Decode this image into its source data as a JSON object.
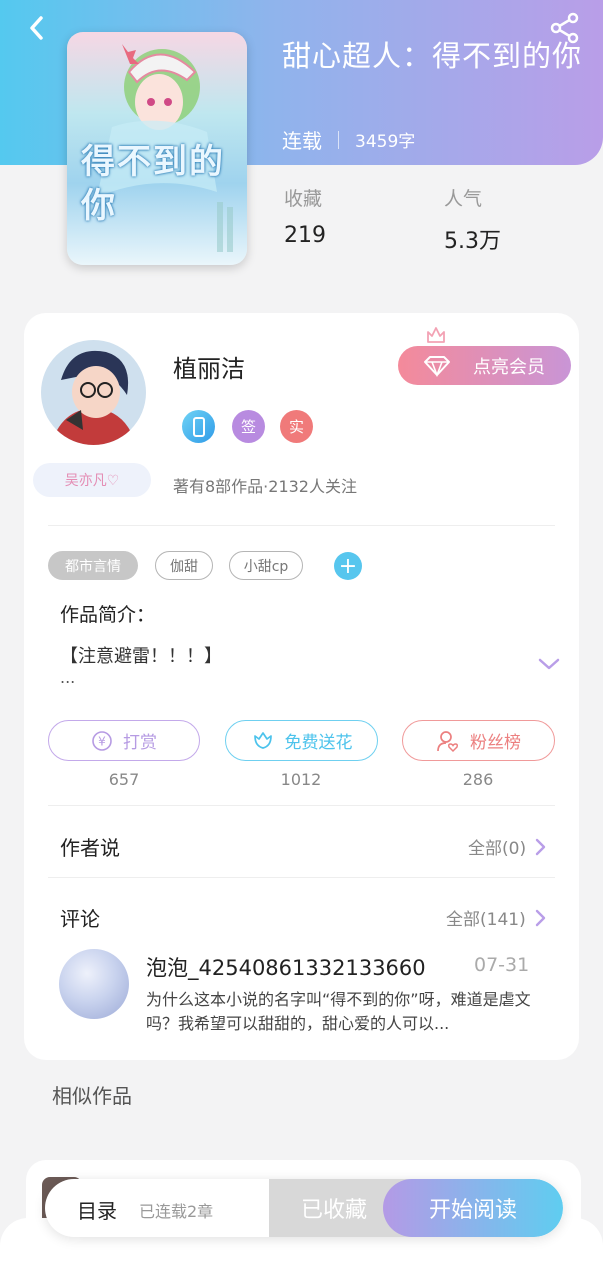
{
  "book": {
    "title": "甜心超人：得不到的你",
    "status": "连载",
    "word_count": "3459字",
    "stats": [
      {
        "label": "收藏",
        "value": "219"
      },
      {
        "label": "人气",
        "value": "5.3万"
      }
    ],
    "cover_text": "得不到的你"
  },
  "author": {
    "name": "植丽洁",
    "vip_button": "点亮会员",
    "badges": [
      "签",
      "实"
    ],
    "tag": "吴亦凡♡",
    "summary": "著有8部作品·2132人关注"
  },
  "tags": [
    "都市言情",
    "伽甜",
    "小甜cp"
  ],
  "intro": {
    "title": "作品简介：",
    "text": "【注意避雷！！！】",
    "more": "..."
  },
  "actions": [
    {
      "label": "打赏",
      "count": "657"
    },
    {
      "label": "免费送花",
      "count": "1012"
    },
    {
      "label": "粉丝榜",
      "count": "286"
    }
  ],
  "author_says": {
    "title": "作者说",
    "link": "全部(0)"
  },
  "comments": {
    "title": "评论",
    "link": "全部(141)",
    "items": [
      {
        "user": "泡泡_42540861332133660",
        "date": "07-31",
        "text": "为什么这本小说的名字叫“得不到的你”呀，难道是虐文吗？我希望可以甜甜的，甜心爱的人可以..."
      }
    ]
  },
  "similar": {
    "title": "相似作品"
  },
  "bottom_bar": {
    "toc": "目录",
    "toc_sub": "已连载2章",
    "fav": "已收藏",
    "read": "开始阅读"
  },
  "colors": {
    "header_start": "#54c9ef",
    "header_end": "#b99ee8",
    "tip": "#b99ee8",
    "flower": "#57c6ee",
    "fans": "#ef8a8a"
  }
}
